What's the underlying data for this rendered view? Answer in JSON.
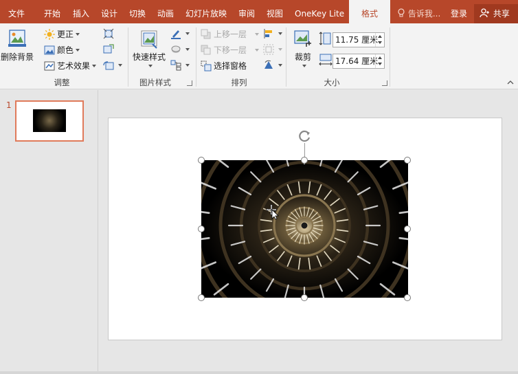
{
  "tabs": [
    {
      "label": "文件"
    },
    {
      "label": "开始"
    },
    {
      "label": "插入"
    },
    {
      "label": "设计"
    },
    {
      "label": "切换"
    },
    {
      "label": "动画"
    },
    {
      "label": "幻灯片放映"
    },
    {
      "label": "审阅"
    },
    {
      "label": "视图"
    },
    {
      "label": "OneKey Lite"
    },
    {
      "label": "格式"
    }
  ],
  "tell_me": "告诉我...",
  "login": "登录",
  "share": "共享",
  "ribbon": {
    "adjust": {
      "remove_bg": "删除背景",
      "corrections": "更正",
      "color": "颜色",
      "artistic": "艺术效果",
      "label": "调整"
    },
    "picture_styles": {
      "quick_styles": "快速样式",
      "label": "图片样式"
    },
    "arrange": {
      "bring_forward": "上移一层",
      "send_backward": "下移一层",
      "selection_pane": "选择窗格",
      "label": "排列"
    },
    "size": {
      "crop": "裁剪",
      "height": "11.75 厘米",
      "width": "17.64 厘米",
      "label": "大小"
    }
  },
  "slides": {
    "current_number": "1"
  },
  "colors": {
    "accent": "#b7472a",
    "ribbon": "#f3f3f3",
    "thumb_border": "#e07a5a"
  }
}
